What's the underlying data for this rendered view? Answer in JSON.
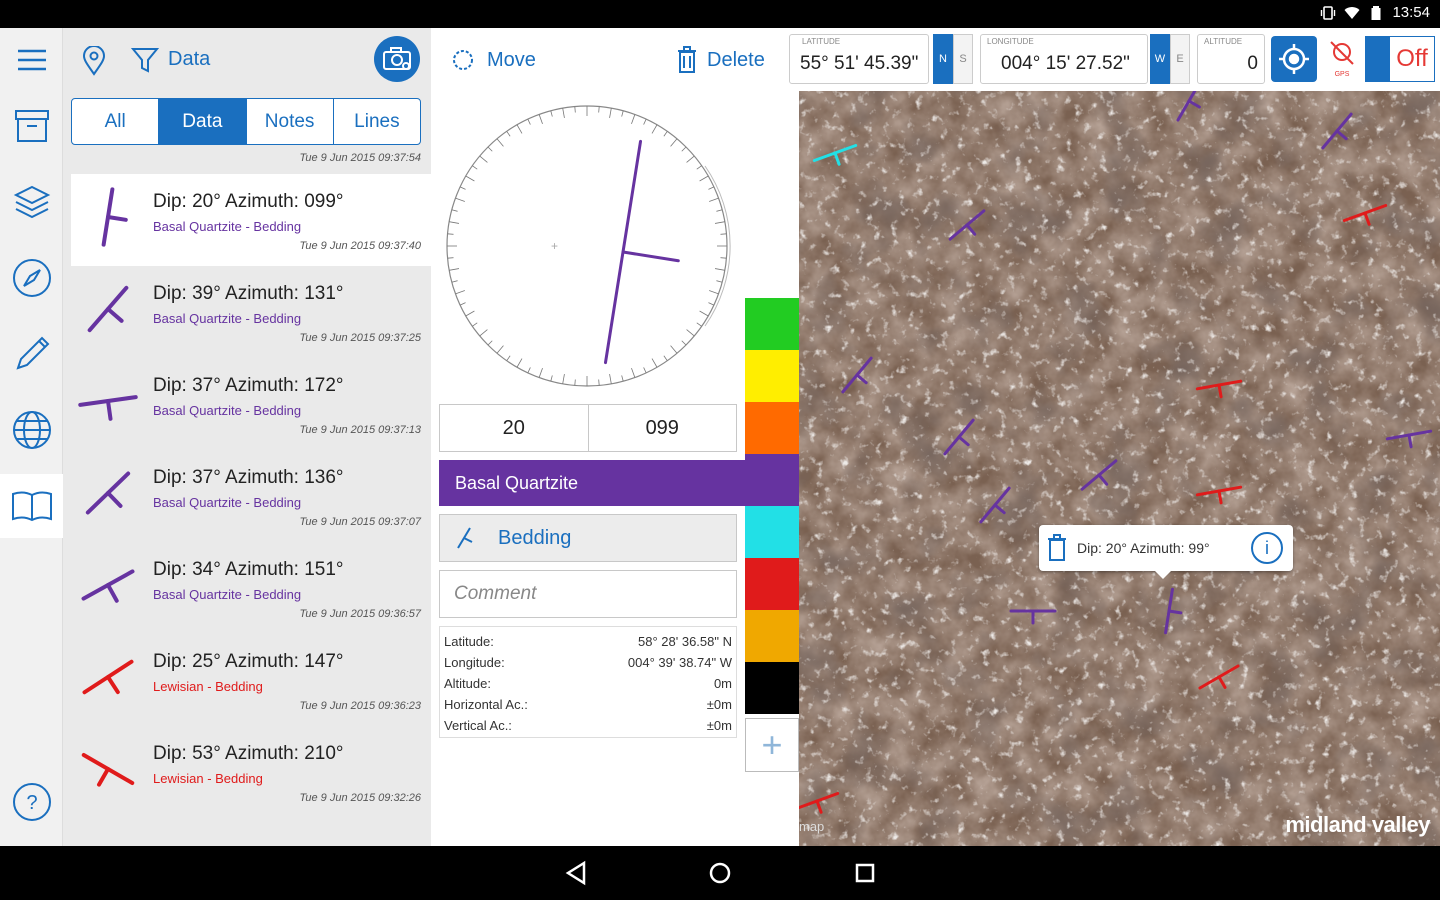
{
  "status": {
    "time": "13:54"
  },
  "rail": {
    "items": [
      "menu-icon",
      "archive-icon",
      "layers-icon",
      "compass-icon",
      "pencil-icon",
      "globe-icon",
      "book-icon",
      "help-icon"
    ]
  },
  "list": {
    "filter_label": "Data",
    "tabs": [
      {
        "label": "All",
        "active": false
      },
      {
        "label": "Data",
        "active": true
      },
      {
        "label": "Notes",
        "active": false
      },
      {
        "label": "Lines",
        "active": false
      }
    ],
    "header_timestamp": "Tue 9 Jun 2015 09:37:54",
    "items": [
      {
        "title": "Dip: 20°  Azimuth: 099°",
        "sub": "Basal Quartzite - Bedding",
        "time": "Tue 9 Jun 2015 09:37:40",
        "color": "#6633a0",
        "azimuth": 99,
        "selected": true
      },
      {
        "title": "Dip: 39°  Azimuth: 131°",
        "sub": "Basal Quartzite - Bedding",
        "time": "Tue 9 Jun 2015 09:37:25",
        "color": "#6633a0",
        "azimuth": 131,
        "selected": false
      },
      {
        "title": "Dip: 37°  Azimuth: 172°",
        "sub": "Basal Quartzite - Bedding",
        "time": "Tue 9 Jun 2015 09:37:13",
        "color": "#6633a0",
        "azimuth": 172,
        "selected": false
      },
      {
        "title": "Dip: 37°  Azimuth: 136°",
        "sub": "Basal Quartzite - Bedding",
        "time": "Tue 9 Jun 2015 09:37:07",
        "color": "#6633a0",
        "azimuth": 136,
        "selected": false
      },
      {
        "title": "Dip: 34°  Azimuth: 151°",
        "sub": "Basal Quartzite - Bedding",
        "time": "Tue 9 Jun 2015 09:36:57",
        "color": "#6633a0",
        "azimuth": 151,
        "selected": false
      },
      {
        "title": "Dip: 25°  Azimuth: 147°",
        "sub": "Lewisian - Bedding",
        "time": "Tue 9 Jun 2015 09:36:23",
        "color": "#e01b1b",
        "azimuth": 147,
        "selected": false
      },
      {
        "title": "Dip: 53°  Azimuth: 210°",
        "sub": "Lewisian - Bedding",
        "time": "Tue 9 Jun 2015 09:32:26",
        "color": "#e01b1b",
        "azimuth": 210,
        "selected": false
      }
    ]
  },
  "editor": {
    "move_label": "Move",
    "delete_label": "Delete",
    "dip": "20",
    "azimuth": "099",
    "unit": "Basal Quartzite",
    "type": "Bedding",
    "comment_placeholder": "Comment",
    "swatches": [
      "#22cc22",
      "#ffee00",
      "#ff6a00",
      "#6633a0",
      "#22e0e6",
      "#e01b1b",
      "#f0a800",
      "#000000"
    ],
    "location": [
      {
        "label": "Latitude:",
        "value": "58° 28' 36.58\" N"
      },
      {
        "label": "Longitude:",
        "value": "004° 39' 38.74\" W"
      },
      {
        "label": "Altitude:",
        "value": "0m"
      },
      {
        "label": "Horizontal Ac.:",
        "value": "±0m"
      },
      {
        "label": "Vertical Ac.:",
        "value": "±0m"
      }
    ]
  },
  "map": {
    "latitude_label": "LATITUDE",
    "latitude": "55° 51' 45.39\"",
    "lat_n": "N",
    "lat_s": "S",
    "longitude_label": "LONGITUDE",
    "longitude": "004° 15' 27.52\"",
    "lon_w": "W",
    "lon_e": "E",
    "altitude_label": "ALTITUDE",
    "altitude": "0",
    "gps_label": "GPS",
    "toggle_label": "Off",
    "popup_text": "Dip: 20°  Azimuth: 99°",
    "brand": "midland valley",
    "scale_text": "map"
  }
}
